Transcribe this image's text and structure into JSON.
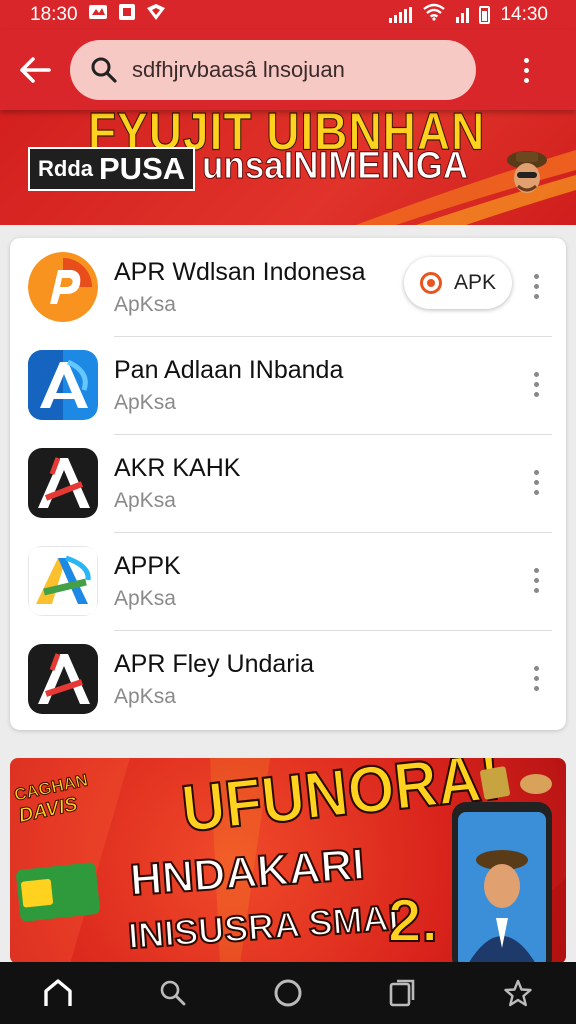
{
  "status_bar": {
    "time_left": "18:30",
    "time_right": "14:30"
  },
  "search": {
    "query": "sdfhjrvbaasâ lnsojuan"
  },
  "top_banner": {
    "title": "FYUJIT UIBNHAN",
    "chip_small": "Rdda",
    "chip_big": "PUSA",
    "subtitle": "unsaINIMEINGA"
  },
  "apps": [
    {
      "name": "APR Wdlsan Indonesa",
      "subtitle": "ApKsa",
      "button_label": "APK"
    },
    {
      "name": "Pan Adlaan INbanda",
      "subtitle": "ApKsa"
    },
    {
      "name": "AKR KAHK",
      "subtitle": "ApKsa"
    },
    {
      "name": "APPK",
      "subtitle": "ApKsa"
    },
    {
      "name": "APR Fley Undaria",
      "subtitle": "ApKsa"
    }
  ],
  "promo": {
    "badge_line1": "CAGHAN",
    "badge_line2": "DAVIS",
    "line1": "UFUNORA!",
    "line2": "HNDAKARI",
    "line3": "INISUSRA SMAI",
    "big_number": "2."
  },
  "nav": [
    "home-icon",
    "search-icon",
    "circle-icon",
    "recents-icon",
    "star-icon"
  ],
  "colors": {
    "brand_red": "#d9262a",
    "banner_yellow": "#ffd21f",
    "apk_orange": "#e8551f"
  }
}
